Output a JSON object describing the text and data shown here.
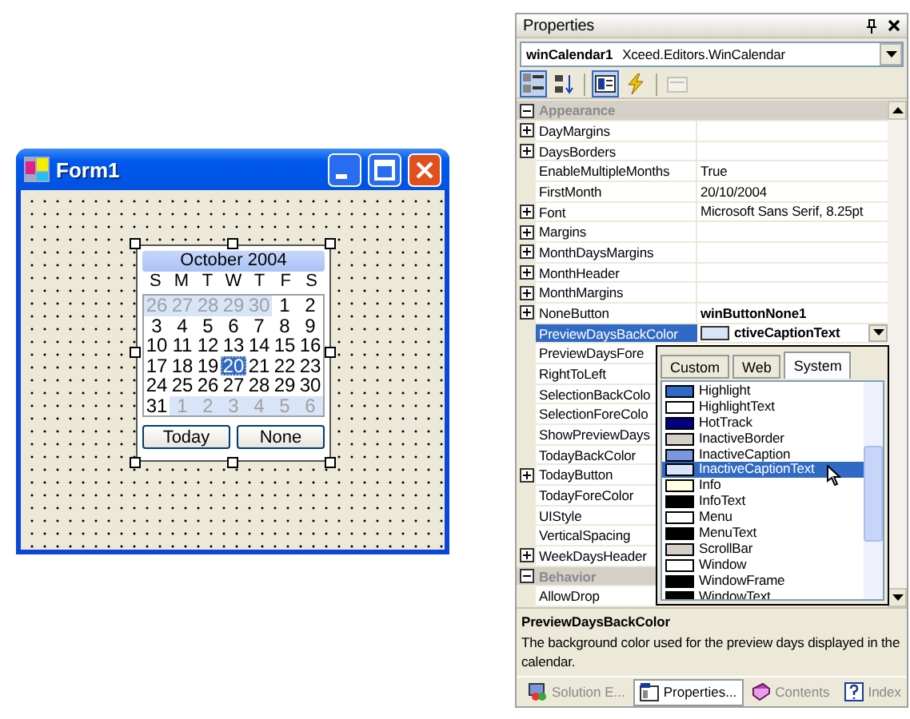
{
  "form": {
    "title": "Form1",
    "calendar": {
      "month": "October 2004",
      "weekdays": [
        "S",
        "M",
        "T",
        "W",
        "T",
        "F",
        "S"
      ],
      "weeks": [
        [
          {
            "day": "26",
            "preview": true,
            "selected": false
          },
          {
            "day": "27",
            "preview": true,
            "selected": false
          },
          {
            "day": "28",
            "preview": true,
            "selected": false
          },
          {
            "day": "29",
            "preview": true,
            "selected": false
          },
          {
            "day": "30",
            "preview": true,
            "selected": false
          },
          {
            "day": "1",
            "preview": false,
            "selected": false
          },
          {
            "day": "2",
            "preview": false,
            "selected": false
          }
        ],
        [
          {
            "day": "3",
            "preview": false,
            "selected": false
          },
          {
            "day": "4",
            "preview": false,
            "selected": false
          },
          {
            "day": "5",
            "preview": false,
            "selected": false
          },
          {
            "day": "6",
            "preview": false,
            "selected": false
          },
          {
            "day": "7",
            "preview": false,
            "selected": false
          },
          {
            "day": "8",
            "preview": false,
            "selected": false
          },
          {
            "day": "9",
            "preview": false,
            "selected": false
          }
        ],
        [
          {
            "day": "10",
            "preview": false,
            "selected": false
          },
          {
            "day": "11",
            "preview": false,
            "selected": false
          },
          {
            "day": "12",
            "preview": false,
            "selected": false
          },
          {
            "day": "13",
            "preview": false,
            "selected": false
          },
          {
            "day": "14",
            "preview": false,
            "selected": false
          },
          {
            "day": "15",
            "preview": false,
            "selected": false
          },
          {
            "day": "16",
            "preview": false,
            "selected": false
          }
        ],
        [
          {
            "day": "17",
            "preview": false,
            "selected": false
          },
          {
            "day": "18",
            "preview": false,
            "selected": false
          },
          {
            "day": "19",
            "preview": false,
            "selected": false
          },
          {
            "day": "20",
            "preview": false,
            "selected": true
          },
          {
            "day": "21",
            "preview": false,
            "selected": false
          },
          {
            "day": "22",
            "preview": false,
            "selected": false
          },
          {
            "day": "23",
            "preview": false,
            "selected": false
          }
        ],
        [
          {
            "day": "24",
            "preview": false,
            "selected": false
          },
          {
            "day": "25",
            "preview": false,
            "selected": false
          },
          {
            "day": "26",
            "preview": false,
            "selected": false
          },
          {
            "day": "27",
            "preview": false,
            "selected": false
          },
          {
            "day": "28",
            "preview": false,
            "selected": false
          },
          {
            "day": "29",
            "preview": false,
            "selected": false
          },
          {
            "day": "30",
            "preview": false,
            "selected": false
          }
        ],
        [
          {
            "day": "31",
            "preview": false,
            "selected": false
          },
          {
            "day": "1",
            "preview": true,
            "selected": false
          },
          {
            "day": "2",
            "preview": true,
            "selected": false
          },
          {
            "day": "3",
            "preview": true,
            "selected": false
          },
          {
            "day": "4",
            "preview": true,
            "selected": false
          },
          {
            "day": "5",
            "preview": true,
            "selected": false
          },
          {
            "day": "6",
            "preview": true,
            "selected": false
          }
        ]
      ],
      "buttons": [
        "Today",
        "None"
      ]
    }
  },
  "properties": {
    "title": "Properties",
    "object_name": "winCalendar1",
    "object_type": "Xceed.Editors.WinCalendar",
    "toolbar": [
      {
        "kind": "categorized",
        "selected": true,
        "disabled": false
      },
      {
        "kind": "alphabetical",
        "selected": false,
        "disabled": false
      },
      {
        "kind": "properties",
        "selected": true,
        "disabled": false
      },
      {
        "kind": "events",
        "selected": false,
        "disabled": false
      },
      {
        "kind": "pages",
        "selected": false,
        "disabled": true
      }
    ],
    "rows": [
      {
        "kind": "category",
        "name": "Appearance",
        "expanded": true
      },
      {
        "kind": "property",
        "name": "DayMargins",
        "expandable": true,
        "selected": false
      },
      {
        "kind": "property",
        "name": "DaysBorders",
        "expandable": true,
        "selected": false
      },
      {
        "kind": "property",
        "name": "EnableMultipleMonths",
        "value": "True",
        "expandable": false,
        "selected": false
      },
      {
        "kind": "property",
        "name": "FirstMonth",
        "value": "20/10/2004",
        "expandable": false,
        "selected": false
      },
      {
        "kind": "property",
        "name": "Font",
        "value": "Microsoft Sans Serif, 8.25pt",
        "expandable": true,
        "selected": false
      },
      {
        "kind": "property",
        "name": "Margins",
        "expandable": true,
        "selected": false
      },
      {
        "kind": "property",
        "name": "MonthDaysMargins",
        "expandable": true,
        "selected": false
      },
      {
        "kind": "property",
        "name": "MonthHeader",
        "expandable": true,
        "selected": false
      },
      {
        "kind": "property",
        "name": "MonthMargins",
        "expandable": true,
        "selected": false
      },
      {
        "kind": "property",
        "name": "NoneButton",
        "value": "winButtonNone1",
        "bold": true,
        "expandable": true,
        "selected": false
      },
      {
        "kind": "property",
        "name": "PreviewDaysBackColor",
        "value": "ctiveCaptionText",
        "bold": true,
        "color": "#d8e4f8",
        "expandable": false,
        "selected": true
      },
      {
        "kind": "property",
        "name": "PreviewDaysFore",
        "expandable": false,
        "selected": false
      },
      {
        "kind": "property",
        "name": "RightToLeft",
        "expandable": false,
        "selected": false
      },
      {
        "kind": "property",
        "name": "SelectionBackColo",
        "expandable": false,
        "selected": false
      },
      {
        "kind": "property",
        "name": "SelectionForeColo",
        "expandable": false,
        "selected": false
      },
      {
        "kind": "property",
        "name": "ShowPreviewDays",
        "expandable": false,
        "selected": false
      },
      {
        "kind": "property",
        "name": "TodayBackColor",
        "expandable": false,
        "selected": false
      },
      {
        "kind": "property",
        "name": "TodayButton",
        "expandable": true,
        "selected": false
      },
      {
        "kind": "property",
        "name": "TodayForeColor",
        "expandable": false,
        "selected": false
      },
      {
        "kind": "property",
        "name": "UIStyle",
        "expandable": false,
        "selected": false
      },
      {
        "kind": "property",
        "name": "VerticalSpacing",
        "expandable": false,
        "selected": false
      },
      {
        "kind": "property",
        "name": "WeekDaysHeader",
        "expandable": true,
        "selected": false
      },
      {
        "kind": "category",
        "name": "Behavior",
        "expanded": true
      },
      {
        "kind": "property",
        "name": "AllowDrop",
        "expandable": false,
        "selected": false
      }
    ],
    "color_picker": {
      "tabs": [
        {
          "label": "Custom",
          "selected": false
        },
        {
          "label": "Web",
          "selected": false
        },
        {
          "label": "System",
          "selected": true
        }
      ],
      "items": [
        {
          "name": "Highlight",
          "color": "#316ac5",
          "selected": false
        },
        {
          "name": "HighlightText",
          "color": "#ffffff",
          "selected": false
        },
        {
          "name": "HotTrack",
          "color": "#000080",
          "selected": false
        },
        {
          "name": "InactiveBorder",
          "color": "#d4d0c8",
          "selected": false
        },
        {
          "name": "InactiveCaption",
          "color": "#7a96df",
          "selected": false
        },
        {
          "name": "InactiveCaptionText",
          "color": "#d8e4f8",
          "selected": true
        },
        {
          "name": "Info",
          "color": "#ffffe1",
          "selected": false
        },
        {
          "name": "InfoText",
          "color": "#000000",
          "selected": false
        },
        {
          "name": "Menu",
          "color": "#ffffff",
          "selected": false
        },
        {
          "name": "MenuText",
          "color": "#000000",
          "selected": false
        },
        {
          "name": "ScrollBar",
          "color": "#d4d0c8",
          "selected": false
        },
        {
          "name": "Window",
          "color": "#ffffff",
          "selected": false
        },
        {
          "name": "WindowFrame",
          "color": "#000000",
          "selected": false
        },
        {
          "name": "WindowText",
          "color": "#000000",
          "selected": false
        }
      ]
    },
    "description": {
      "title": "PreviewDaysBackColor",
      "text": "The background color used for the preview days displayed in the calendar."
    },
    "bottom_tabs": [
      {
        "label": "Solution E...",
        "kind": "solution",
        "selected": false
      },
      {
        "label": "Properties...",
        "kind": "properties",
        "selected": true
      },
      {
        "label": "Contents",
        "kind": "contents",
        "selected": false
      },
      {
        "label": "Index",
        "kind": "index",
        "selected": false
      }
    ]
  }
}
